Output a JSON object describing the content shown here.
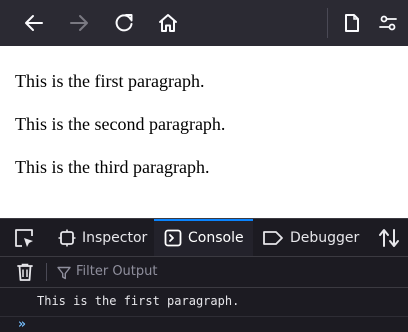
{
  "toolbar": {
    "back_icon": "arrow-left-icon",
    "forward_icon": "arrow-right-icon",
    "reload_icon": "reload-icon",
    "home_icon": "home-icon",
    "page_icon": "page-icon",
    "settings_icon": "sliders-icon"
  },
  "page": {
    "paragraphs": [
      "This is the first paragraph.",
      "This is the second paragraph.",
      "This is the third paragraph."
    ]
  },
  "devtools": {
    "tabs": [
      {
        "label": "Inspector",
        "active": false
      },
      {
        "label": "Console",
        "active": true
      },
      {
        "label": "Debugger",
        "active": false
      }
    ],
    "filter_placeholder": "Filter Output",
    "console_messages": [
      "This is the first paragraph."
    ],
    "prompt": "»"
  },
  "colors": {
    "toolbar_bg": "#2b2a33",
    "devtools_bg": "#1c1b22",
    "accent": "#0a84ff",
    "prompt": "#75bfff"
  }
}
